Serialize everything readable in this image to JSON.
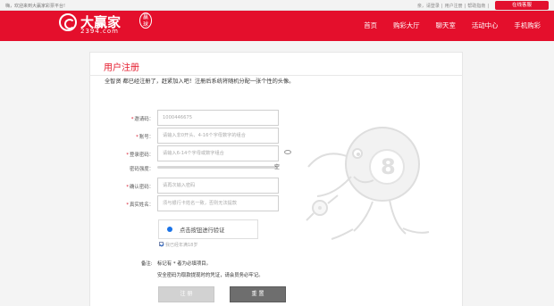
{
  "topbar": {
    "welcome": "嗨，欢迎来到大赢家彩票平台!",
    "links": [
      "亲，请登录",
      "|",
      "用户注册",
      "|",
      "帮助指南",
      "|"
    ],
    "service": "在线客服"
  },
  "brand": {
    "name": "大赢家",
    "domain": "2394.com",
    "badge": "贏\n球"
  },
  "nav": [
    "首页",
    "购彩大厅",
    "聊天室",
    "活动中心",
    "手机购彩"
  ],
  "page": {
    "title": "用户注册",
    "intro": "全智贤 都已经注册了，赶紧加入吧！注册后系统将随机分配一张个性的头像。"
  },
  "form": {
    "invite": {
      "label": "邀请码：",
      "value": "1000446675"
    },
    "account": {
      "label": "账号：",
      "placeholder": "请输入非0开头、4-16个字母数字的组合"
    },
    "password": {
      "label": "登录密码：",
      "placeholder": "请输入6-14个字母或数字组合"
    },
    "strength": {
      "label": "密码强度：",
      "end": "空"
    },
    "confirm": {
      "label": "确认密码：",
      "placeholder": "请再次输入密码"
    },
    "realname": {
      "label": "真实姓名：",
      "placeholder": "须与银行卡姓名一致，否则无法提款"
    },
    "verify_text": "点击按钮进行验证",
    "agreement_label": "我已经年满18岁",
    "notes_label": "备注:",
    "notes": [
      "标记有 * 者为必填项目。",
      "安全密码为取款提现时的凭证，请会员务必牢记。"
    ],
    "submit": "注 册",
    "reset": "重 置"
  },
  "colors": {
    "brand_red": "#e40f2c",
    "title_red": "#e51b2d",
    "verify_blue": "#1a73e8",
    "disabled_gray": "#d2d2d2",
    "reset_gray": "#6e6e6e"
  }
}
